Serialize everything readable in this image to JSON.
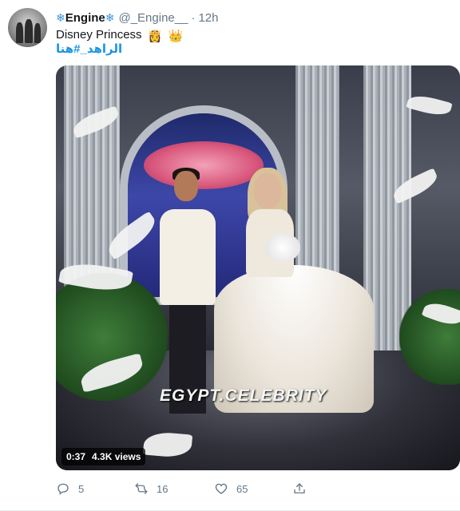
{
  "tweet": {
    "display_name": "Engine",
    "name_decoration": "❄",
    "handle": "@_Engine__",
    "separator": "·",
    "time": "12h",
    "text": "Disney Princess",
    "emoji_1": "👸",
    "emoji_2": "👑",
    "hashtag": "الراهد_#هنا",
    "media": {
      "watermark": "EGYPT.CELEBRITY",
      "duration": "0:37",
      "views": "4.3K views"
    },
    "actions": {
      "replies": "5",
      "retweets": "16",
      "likes": "65"
    }
  },
  "colors": {
    "link": "#1b95e0",
    "secondary_text": "#657786",
    "name_snowflake": "#3b94d9"
  },
  "icons": [
    "reply-icon",
    "retweet-icon",
    "like-icon",
    "share-icon",
    "snowflake-icon"
  ]
}
